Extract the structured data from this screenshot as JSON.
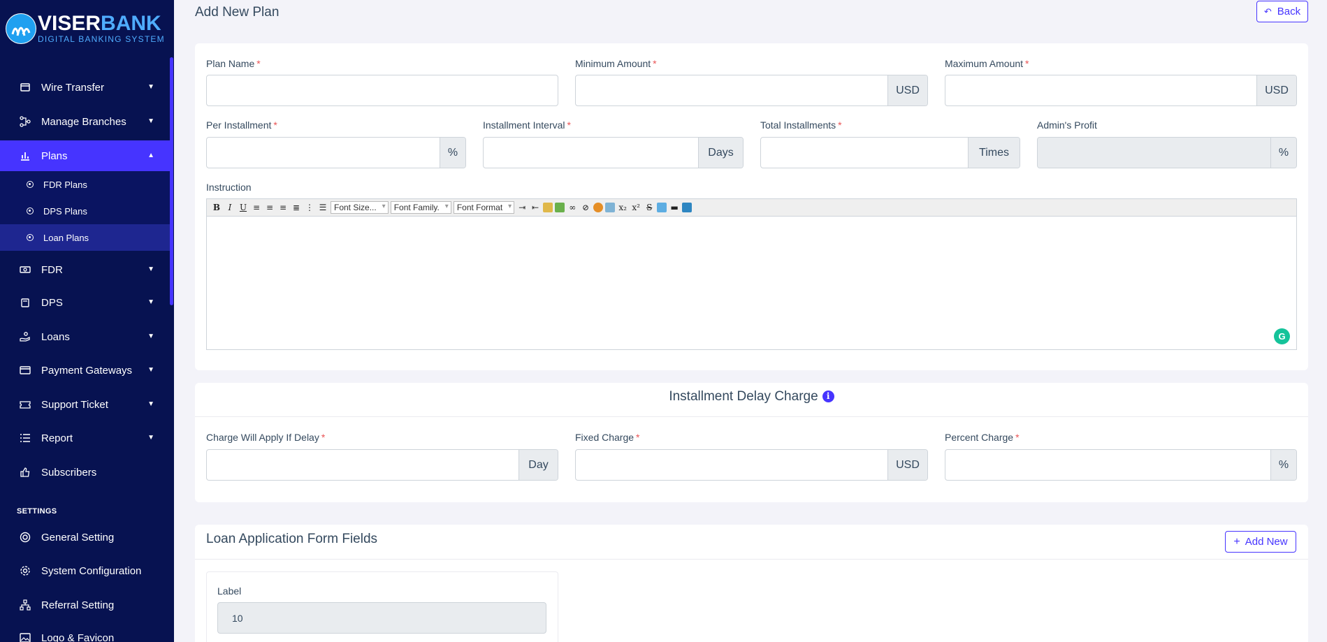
{
  "brand": {
    "name_white": "VISER",
    "name_blue": "BANK",
    "tagline": "DIGITAL BANKING SYSTEM"
  },
  "sidebar": {
    "items": [
      {
        "label": "Wire Transfer",
        "icon": "wire-transfer-icon"
      },
      {
        "label": "Manage Branches",
        "icon": "branches-icon"
      },
      {
        "label": "Plans",
        "icon": "bar-chart-icon"
      },
      {
        "label": "FDR",
        "icon": "money-icon"
      },
      {
        "label": "DPS",
        "icon": "savings-icon"
      },
      {
        "label": "Loans",
        "icon": "hand-money-icon"
      },
      {
        "label": "Payment Gateways",
        "icon": "credit-card-icon"
      },
      {
        "label": "Support Ticket",
        "icon": "ticket-icon"
      },
      {
        "label": "Report",
        "icon": "list-icon"
      },
      {
        "label": "Subscribers",
        "icon": "thumbs-up-icon"
      }
    ],
    "plans_sub": [
      "FDR Plans",
      "DPS Plans",
      "Loan Plans"
    ],
    "settings_title": "SETTINGS",
    "settings_items": [
      {
        "label": "General Setting",
        "icon": "life-ring-icon"
      },
      {
        "label": "System Configuration",
        "icon": "gear-icon"
      },
      {
        "label": "Referral Setting",
        "icon": "sitemap-icon"
      },
      {
        "label": "Logo & Favicon",
        "icon": "image-icon"
      }
    ]
  },
  "page": {
    "title": "Add New Plan",
    "back_label": "Back"
  },
  "form": {
    "plan_name": {
      "label": "Plan Name",
      "value": ""
    },
    "minimum_amount": {
      "label": "Minimum Amount",
      "addon": "USD"
    },
    "maximum_amount": {
      "label": "Maximum Amount",
      "addon": "USD"
    },
    "per_installment": {
      "label": "Per Installment",
      "addon": "%"
    },
    "installment_interval": {
      "label": "Installment Interval",
      "addon": "Days"
    },
    "total_installments": {
      "label": "Total Installments",
      "addon": "Times"
    },
    "admins_profit": {
      "label": "Admin's Profit",
      "addon": "%"
    },
    "instruction": {
      "label": "Instruction",
      "font_size": "Font Size...",
      "font_family": "Font Family.",
      "font_format": "Font Format"
    }
  },
  "delay_charge": {
    "title": "Installment Delay Charge",
    "charge_apply": {
      "label": "Charge Will Apply If Delay",
      "addon": "Day"
    },
    "fixed_charge": {
      "label": "Fixed Charge",
      "addon": "USD"
    },
    "percent_charge": {
      "label": "Percent Charge",
      "addon": "%"
    }
  },
  "form_fields": {
    "title": "Loan Application Form Fields",
    "add_label": "Add New",
    "field_label": "Label",
    "field_value": "10"
  },
  "colors": {
    "sidebar_bg": "#071251",
    "accent": "#4634ff",
    "required": "#ea5455"
  }
}
